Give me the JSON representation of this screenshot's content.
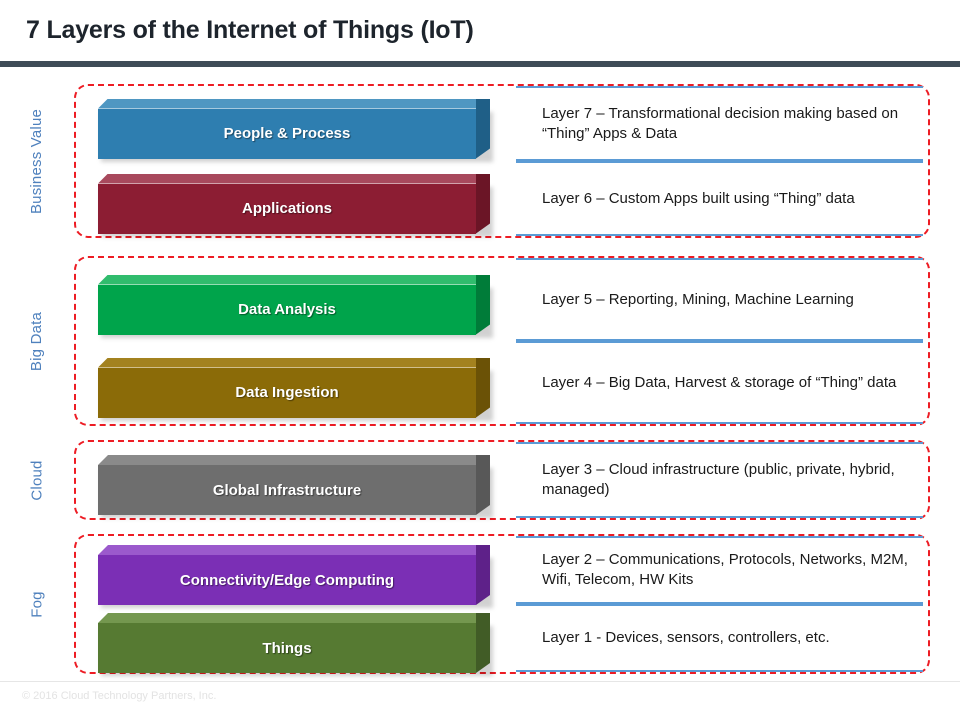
{
  "slide": {
    "title": "7 Layers of the Internet of Things (IoT)",
    "footer": "© 2016 Cloud Technology Partners, Inc.",
    "accent_rule_color": "#3e4c57",
    "group_border_color": "#ed1c24",
    "desc_rule_color": "#5b9bd5",
    "side_label_color": "#4f81bd"
  },
  "groups": [
    {
      "label": "Business Value",
      "layers": [
        {
          "name": "People & Process",
          "color": "#2E7EB0",
          "top_color": "#4F97C2",
          "side_color": "#1F5F87",
          "description": "Layer 7 – Transformational decision making based on “Thing” Apps & Data"
        },
        {
          "name": "Applications",
          "color": "#8C1D33",
          "top_color": "#A8495D",
          "side_color": "#6B1526",
          "description": "Layer 6 – Custom Apps built using “Thing” data"
        }
      ]
    },
    {
      "label": "Big Data",
      "layers": [
        {
          "name": "Data Analysis",
          "color": "#00A44B",
          "top_color": "#30BC6D",
          "side_color": "#007C39",
          "description": "Layer 5 – Reporting, Mining, Machine Learning"
        },
        {
          "name": "Data Ingestion",
          "color": "#8B6B08",
          "top_color": "#A3821F",
          "side_color": "#6B5206",
          "description": "Layer 4 – Big Data, Harvest & storage of “Thing” data"
        }
      ]
    },
    {
      "label": "Cloud",
      "layers": [
        {
          "name": "Global Infrastructure",
          "color": "#6E6E6E",
          "top_color": "#8A8A8A",
          "side_color": "#585858",
          "description": "Layer 3 – Cloud infrastructure (public, private, hybrid, managed)"
        }
      ]
    },
    {
      "label": "Fog",
      "layers": [
        {
          "name": "Connectivity/Edge Computing",
          "color": "#7B2FB5",
          "top_color": "#9B59CC",
          "side_color": "#5E2189",
          "description": "Layer 2 – Communications, Protocols, Networks, M2M, Wifi, Telecom, HW Kits"
        },
        {
          "name": "Things",
          "color": "#567A32",
          "top_color": "#74974F",
          "side_color": "#415C26",
          "description": "Layer 1 - Devices, sensors, controllers, etc."
        }
      ]
    }
  ],
  "chart_data": {
    "type": "table",
    "title": "7 Layers of the Internet of Things (IoT)",
    "categories": [
      "Business Value",
      "Big Data",
      "Cloud",
      "Fog"
    ],
    "series": [
      {
        "name": "Layers",
        "values": [
          {
            "layer": 7,
            "name": "People & Process",
            "group": "Business Value",
            "description": "Transformational decision making based on “Thing” Apps & Data"
          },
          {
            "layer": 6,
            "name": "Applications",
            "group": "Business Value",
            "description": "Custom Apps built using “Thing” data"
          },
          {
            "layer": 5,
            "name": "Data Analysis",
            "group": "Big Data",
            "description": "Reporting, Mining, Machine Learning"
          },
          {
            "layer": 4,
            "name": "Data Ingestion",
            "group": "Big Data",
            "description": "Big Data, Harvest & storage of “Thing” data"
          },
          {
            "layer": 3,
            "name": "Global Infrastructure",
            "group": "Cloud",
            "description": "Cloud infrastructure (public, private, hybrid, managed)"
          },
          {
            "layer": 2,
            "name": "Connectivity/Edge Computing",
            "group": "Fog",
            "description": "Communications, Protocols, Networks, M2M, Wifi, Telecom, HW Kits"
          },
          {
            "layer": 1,
            "name": "Things",
            "group": "Fog",
            "description": "Devices, sensors, controllers, etc."
          }
        ]
      }
    ]
  }
}
